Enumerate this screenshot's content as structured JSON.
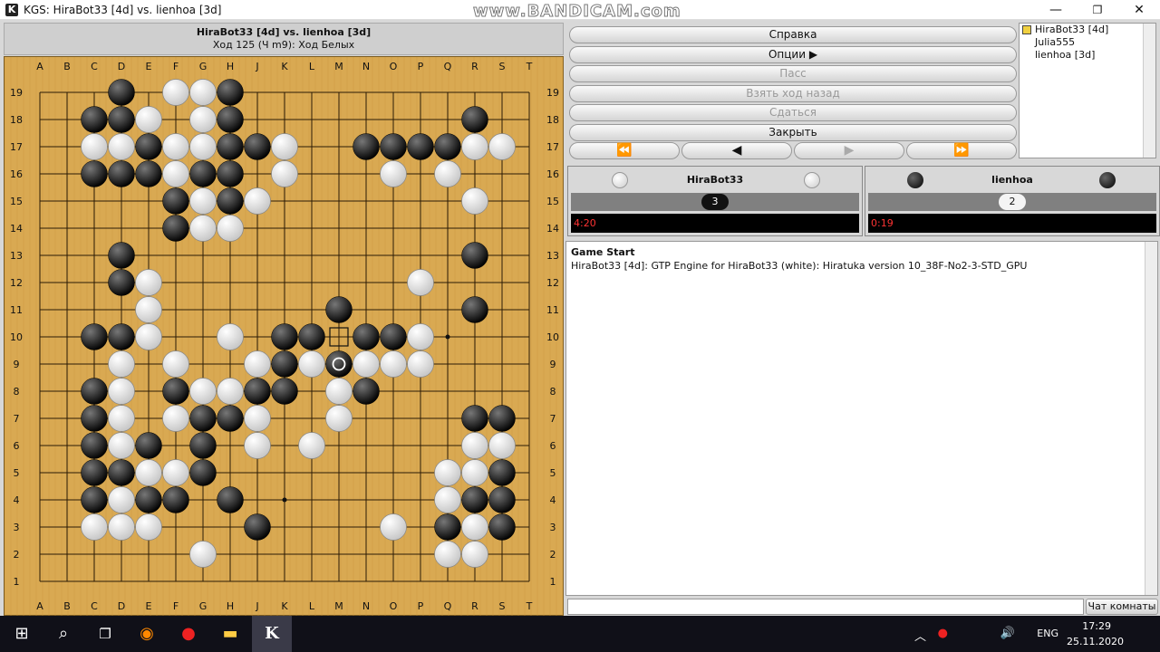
{
  "window": {
    "title": "KGS: HiraBot33 [4d] vs. lienhoa [3d]",
    "watermark": "www.BANDICAM.com",
    "min": "—",
    "max": "❐",
    "close": "✕"
  },
  "game": {
    "title": "HiraBot33 [4d] vs. lienhoa [3d]",
    "move_status": "Ход 125 (Ч m9): Ход Белых"
  },
  "board": {
    "columns": [
      "A",
      "B",
      "C",
      "D",
      "E",
      "F",
      "G",
      "H",
      "J",
      "K",
      "L",
      "M",
      "N",
      "O",
      "P",
      "Q",
      "R",
      "S",
      "T"
    ],
    "rows": [
      "19",
      "18",
      "17",
      "16",
      "15",
      "14",
      "13",
      "12",
      "11",
      "10",
      "9",
      "8",
      "7",
      "6",
      "5",
      "4",
      "3",
      "2",
      "1"
    ],
    "last_move": "M9",
    "marked": "M10",
    "black": [
      "D19",
      "H19",
      "C18",
      "D18",
      "H18",
      "R18",
      "E17",
      "H17",
      "J17",
      "N17",
      "O17",
      "P17",
      "Q17",
      "C16",
      "D16",
      "E16",
      "G16",
      "H16",
      "F15",
      "H15",
      "F14",
      "D13",
      "R13",
      "D12",
      "M11",
      "R11",
      "C10",
      "D10",
      "K10",
      "L10",
      "N10",
      "O10",
      "K9",
      "M9",
      "C8",
      "F8",
      "J8",
      "K8",
      "N8",
      "C7",
      "G7",
      "H7",
      "R7",
      "S7",
      "C6",
      "E6",
      "G6",
      "C5",
      "D5",
      "G5",
      "S5",
      "C4",
      "E4",
      "F4",
      "H4",
      "R4",
      "S4",
      "J3",
      "Q3",
      "S3"
    ],
    "white": [
      "F19",
      "G19",
      "E18",
      "G18",
      "C17",
      "D17",
      "F17",
      "G17",
      "K17",
      "R17",
      "S17",
      "F16",
      "K16",
      "O16",
      "Q16",
      "G15",
      "J15",
      "R15",
      "G14",
      "H14",
      "E12",
      "P12",
      "E11",
      "E10",
      "H10",
      "P10",
      "D9",
      "F9",
      "J9",
      "L9",
      "N9",
      "O9",
      "P9",
      "D8",
      "G8",
      "H8",
      "M8",
      "D7",
      "F7",
      "J7",
      "M7",
      "D6",
      "J6",
      "L6",
      "R6",
      "S6",
      "E5",
      "F5",
      "Q5",
      "R5",
      "D4",
      "Q4",
      "C3",
      "D3",
      "E3",
      "O3",
      "R3",
      "G2",
      "Q2",
      "R2"
    ],
    "hoshi": [
      "D16",
      "K16",
      "Q16",
      "D10",
      "K10",
      "Q10",
      "D4",
      "K4",
      "Q4"
    ]
  },
  "controls": {
    "help": "Справка",
    "options": "Опции",
    "pass": "Пасс",
    "undo": "Взять ход назад",
    "resign": "Сдаться",
    "close": "Закрыть",
    "nav_first": "⏪",
    "nav_prev": "◀",
    "nav_next": "▶",
    "nav_last": "⏩"
  },
  "users": [
    "HiraBot33 [4d]",
    "Julia555",
    "lienhoa [3d]"
  ],
  "player_white": {
    "name": "HiraBot33",
    "captures": "3",
    "clock": "4:20"
  },
  "player_black": {
    "name": "lienhoa",
    "captures": "2",
    "clock": "0:19"
  },
  "chat": {
    "line1": "Game Start",
    "line2": "HiraBot33 [4d]: GTP Engine for HiraBot33 (white): Hiratuka version 10_38F-No2-3-STD_GPU",
    "room_button": "Чат комнаты"
  },
  "taskbar": {
    "lang": "ENG",
    "time": "17:29",
    "date": "25.11.2020",
    "start": "⊞",
    "search": "⌕",
    "taskview": "❐",
    "firefox": "◉",
    "record": "●",
    "folder": "▬",
    "kgs": "K",
    "tray_up": "︿",
    "speaker": "🔊"
  }
}
